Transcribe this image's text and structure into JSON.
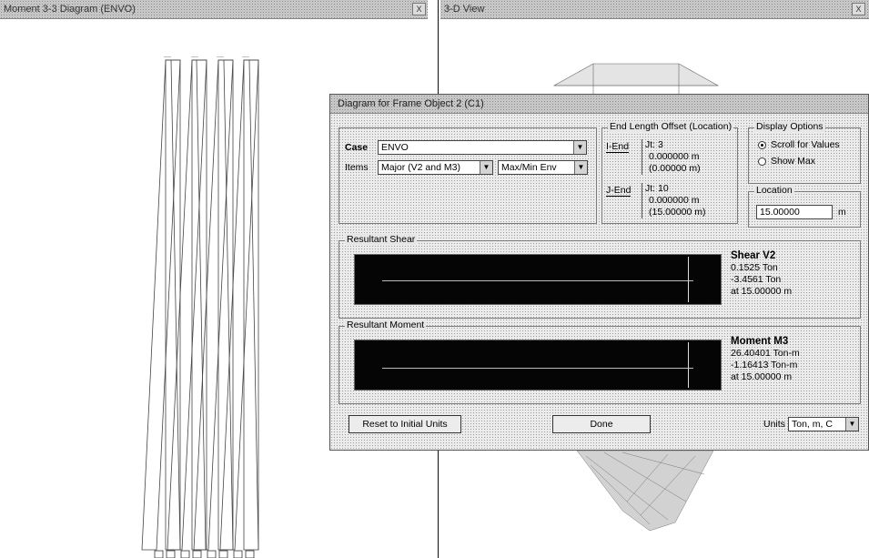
{
  "left_pane": {
    "title": "Moment 3-3 Diagram (ENVO)"
  },
  "right_pane": {
    "title": "3-D View"
  },
  "pane_buttons": {
    "close": "X"
  },
  "dialog": {
    "title": "Diagram for Frame Object 2 (C1)",
    "case": {
      "label": "Case",
      "value": "ENVO"
    },
    "items": {
      "label": "Items",
      "value": "Major (V2 and M3)",
      "env_value": "Max/Min Env"
    },
    "end_offset": {
      "legend": "End Length Offset (Location)",
      "i_end": {
        "label": "I-End",
        "joint": "Jt: 3",
        "offset": "0.000000 m",
        "location": "(0.00000 m)"
      },
      "j_end": {
        "label": "J-End",
        "joint": "Jt: 10",
        "offset": "0.000000 m",
        "location": "(15.00000 m)"
      }
    },
    "display_options": {
      "legend": "Display Options",
      "scroll_label": "Scroll for Values",
      "showmax_label": "Show Max",
      "selected": "scroll"
    },
    "location": {
      "legend": "Location",
      "value": "15.00000",
      "unit": "m"
    },
    "shear": {
      "legend": "Resultant Shear",
      "title": "Shear V2",
      "v1": "0.1525 Ton",
      "v2": "-3.4561 Ton",
      "at": "at 15.00000 m"
    },
    "moment": {
      "legend": "Resultant Moment",
      "title": "Moment M3",
      "v1": "26.40401 Ton-m",
      "v2": "-1.16413 Ton-m",
      "at": "at 15.00000 m"
    },
    "buttons": {
      "reset": "Reset to Initial Units",
      "done": "Done"
    },
    "units": {
      "label": "Units",
      "value": "Ton, m, C"
    }
  },
  "icons": {
    "dropdown": "chevron-down-icon"
  }
}
